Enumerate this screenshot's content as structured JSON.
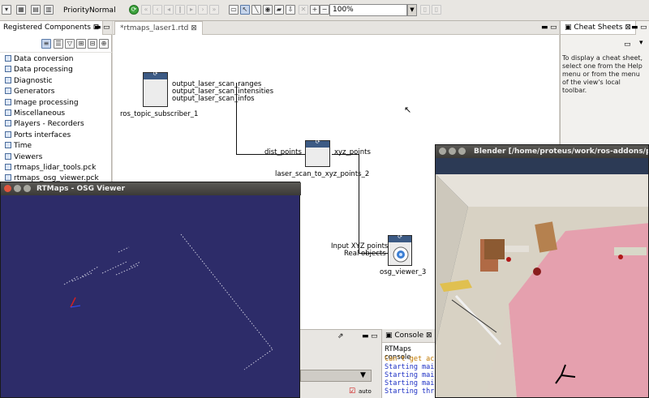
{
  "toolbar": {
    "priority_label": "Priority",
    "priority_value": "Normal",
    "zoom_value": "100%"
  },
  "registered_components": {
    "tab_label": "Registered Components",
    "items": [
      "Data conversion",
      "Data processing",
      "Diagnostic",
      "Generators",
      "Image processing",
      "Miscellaneous",
      "Players - Recorders",
      "Ports interfaces",
      "Time",
      "Viewers",
      "rtmaps_lidar_tools.pck",
      "rtmaps_osg_viewer.pck"
    ]
  },
  "editor": {
    "tab_label": "*rtmaps_laser1.rtd",
    "components": {
      "subscriber": {
        "name": "ros_topic_subscriber_1",
        "outputs": [
          "output_laser_scan_ranges",
          "output_laser_scan_intensities",
          "output_laser_scan_infos"
        ]
      },
      "converter": {
        "name": "laser_scan_to_xyz_points_2",
        "input": "dist_points",
        "output": "xyz_points"
      },
      "viewer": {
        "name": "osg_viewer_3",
        "inputs": [
          "Input XYZ points",
          "Real objects"
        ]
      }
    }
  },
  "cheat_sheets": {
    "tab_label": "Cheat Sheets",
    "text": "To display a cheat sheet, select one from the Help menu or from the menu of the view's local toolbar."
  },
  "console": {
    "tab_label": "Console",
    "title": "RTMaps console",
    "lines": [
      {
        "text": "Can't get acce",
        "color": "#c07800"
      },
      {
        "text": "Starting main",
        "color": "#1c2fc4"
      },
      {
        "text": "Starting main",
        "color": "#1c2fc4"
      },
      {
        "text": "Starting main",
        "color": "#1c2fc4"
      },
      {
        "text": "Starting threa",
        "color": "#1c2fc4"
      }
    ]
  },
  "properties": {
    "auto_label": "auto"
  },
  "osg_window": {
    "title": "RTMaps - OSG Viewer",
    "background": "#2d2c69"
  },
  "blender_window": {
    "title": "Blender [/home/proteus/work/ros-addons/proteus"
  }
}
